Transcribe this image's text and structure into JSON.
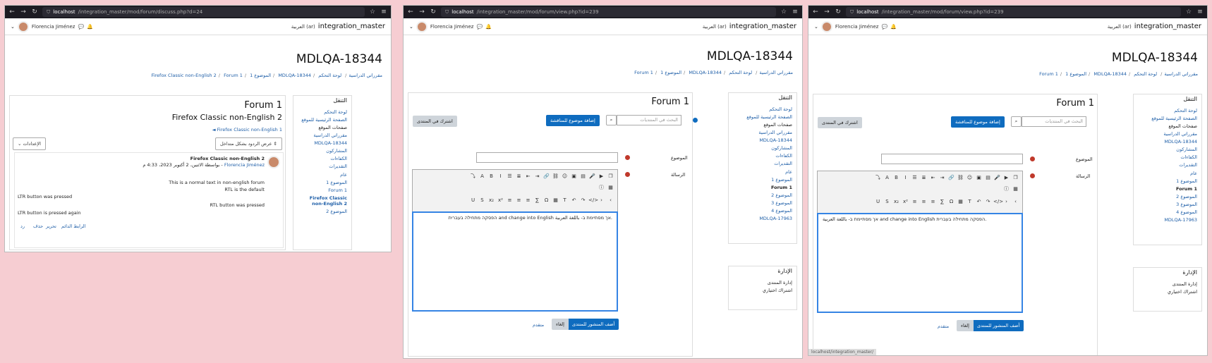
{
  "user": "Florencia Jiménez",
  "site": "integration_master",
  "lang": "العربية (ar)",
  "course": "MDLQA-18344",
  "w1": {
    "url_host": "localhost",
    "url_path": "/integration_master/mod/forum/discuss.php?d=24",
    "crumbs": [
      "لوحة التحكم",
      "مقرراتي الدراسية",
      "MDLQA-18344",
      "الموضوع 1",
      "Forum 1",
      "Firefox Classic non-English 2"
    ],
    "forum": "Forum 1",
    "discussion": "Firefox Classic non-English 2",
    "back_link": "◄ Firefox Classic non-English 1",
    "mode": "عرض الردود بشكل متداخل",
    "settings": "الإعدادات",
    "post_subject": "Firefox Classic non-English 2",
    "post_author": "Florencia Jiménez",
    "post_meta": "بواسطة الاثنين، 2 أكتوبر 2023، 4:33 م -",
    "lines": [
      "This is a normal text in non-english forum",
      "RTL is the default",
      "LTR button was pressed",
      "RTL button was pressed",
      "LTR button is pressed again"
    ],
    "actions": [
      "الرابط الدائم",
      "تحرير",
      "حذف",
      "رد"
    ],
    "nav": {
      "head": "التنقل",
      "items": [
        "لوحة التحكم",
        "الصفحة الرئيسية للموقع",
        "صفحات الموقع",
        "مقرراتي الدراسية",
        "MDLQA-18344",
        "المشاركون",
        "الكفاءات",
        "التقديرات",
        "عام",
        "الموضوع 1",
        "Forum 1",
        "Firefox Classic non-English 2",
        "الموضوع 2"
      ]
    }
  },
  "w2": {
    "url_host": "localhost",
    "url_path": "/integration_master/mod/forum/view.php?id=239",
    "crumbs": [
      "لوحة التحكم",
      "مقرراتي الدراسية",
      "MDLQA-18344",
      "الموضوع 1",
      "Forum 1"
    ],
    "forum": "Forum 1",
    "search_ph": "البحث في المنتديات",
    "add": "إضافة موضوع للمناقشة",
    "subscribe": "اشترك في المنتدى",
    "subject_label": "الموضوع",
    "message_label": "الرسالة",
    "editor_text": "הפסקה מתחילה בעברית and change into English אך מסתיימת ב- باللغة العربية.",
    "post_btn": "أضف المنشور للمنتدى",
    "cancel": "إلغاء",
    "advanced": "متقدم",
    "nav": {
      "head": "التنقل",
      "items": [
        "لوحة التحكم",
        "الصفحة الرئيسية للموقع",
        "صفحات الموقع",
        "مقرراتي الدراسية",
        "MDLQA-18344",
        "المشاركون",
        "الكفاءات",
        "التقديرات",
        "عام",
        "الموضوع 1",
        "Forum 1",
        "الموضوع 2",
        "الموضوع 3",
        "الموضوع 4",
        "MDLQA-17963"
      ]
    },
    "admin": {
      "head": "الإدارة",
      "items": [
        "إدارة المنتدى",
        "اشتراك اختياري"
      ]
    }
  },
  "w3": {
    "url_host": "localhost",
    "url_path": "/integration_master/mod/forum/view.php?id=239",
    "editor_text": "אך מסתיימת ב- باللغة العربية and change into English הפסקה מתחילה בעברית.",
    "status": "localhost/integration_master/"
  }
}
